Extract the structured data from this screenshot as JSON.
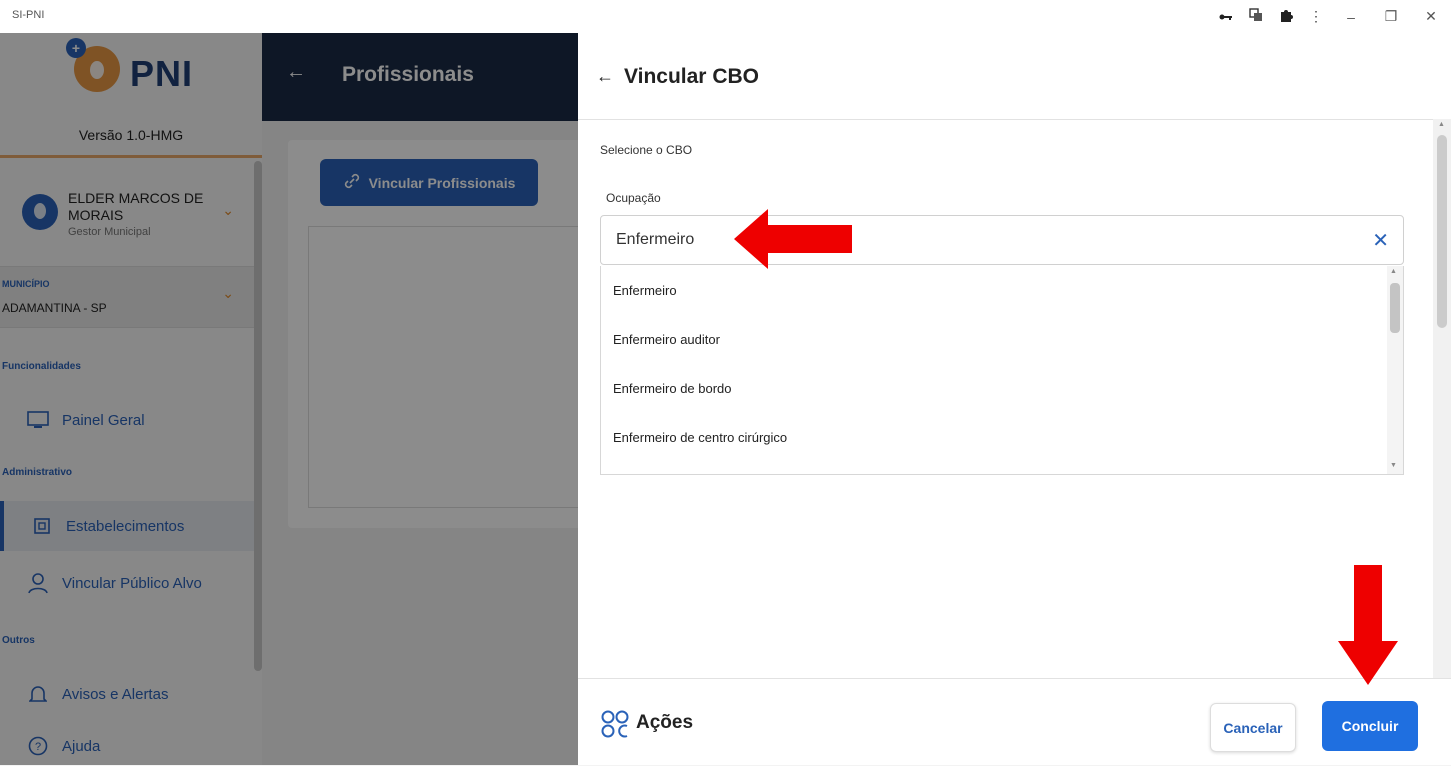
{
  "window": {
    "title": "SI-PNI",
    "controls": {
      "key_icon": "key-icon",
      "translate_icon": "translate-icon",
      "extension_icon": "puzzle-icon",
      "menu_icon": "kebab-icon",
      "minimize": "–",
      "restore": "❐",
      "close": "✕"
    }
  },
  "sidebar": {
    "logo_text": "PNI",
    "version": "Versão 1.0-HMG",
    "user": {
      "name": "ELDER MARCOS DE MORAIS",
      "role": "Gestor Municipal"
    },
    "municipio": {
      "label": "MUNICÍPIO",
      "value": "ADAMANTINA - SP"
    },
    "sections": {
      "funcionalidades": "Funcionalidades",
      "administrativo": "Administrativo",
      "outros": "Outros"
    },
    "items": {
      "painel_geral": "Painel Geral",
      "estabelecimentos": "Estabelecimentos",
      "vincular_publico_alvo": "Vincular Público Alvo",
      "avisos_alertas": "Avisos e Alertas",
      "ajuda": "Ajuda"
    }
  },
  "page": {
    "title": "Profissionais",
    "link_button": "Vincular Profissionais"
  },
  "drawer": {
    "title": "Vincular CBO",
    "select_label": "Selecione o CBO",
    "occupation_label": "Ocupação",
    "occupation_value": "Enfermeiro",
    "options": [
      "Enfermeiro",
      "Enfermeiro auditor",
      "Enfermeiro de bordo",
      "Enfermeiro de centro cirúrgico"
    ],
    "footer": {
      "actions_label": "Ações",
      "cancel": "Cancelar",
      "confirm": "Concluir"
    }
  },
  "colors": {
    "primary": "#2a62b8",
    "primary_button": "#1f6fe0",
    "topbar": "#1b2b45",
    "annotation": "#ee0000",
    "accent": "#e89844"
  }
}
